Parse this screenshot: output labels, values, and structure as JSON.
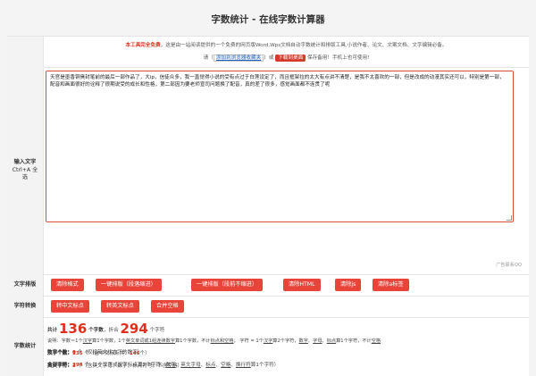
{
  "title": "字数统计 - 在线字数计算器",
  "notice": {
    "highlight": "本工具完全免费",
    "line1_rest": "，这是由一站阅读提供的一个免费的网页版Word,Wps文档自动字数统计和排版工具,小说作者、论文、文案文档、文字编辑必备。",
    "line2_prefix": "请（",
    "favorite_link": "添加到浏览器收藏夹",
    "line2_mid": "）或",
    "download_button": "下载到桌面",
    "line2_suffix": "保存备用！手机上也可使用!"
  },
  "input": {
    "label_line1": "输入文字",
    "label_line2": "Ctrl+A 全",
    "label_line3": "选",
    "text": "天官是墨香铜臭封笔前的最后一部作品了，大ip，信徒众多，我一直觉得小说的受有点过于白莲设定了，而且框架拉的太大有点讲不清楚，是我不太喜欢的一部，但是改成的动漫其实还可以，特别是第一部，配音和画面很好的诠释了很期说受的成长和性格，第二部因为要老师宣司问题换了配音，真的差了很多，感觉画面都不连贯了呢",
    "ad_note": "广告联系QQ"
  },
  "format": {
    "label": "文字排版",
    "buttons": [
      "清除格式",
      "一键排版（段落缩进）",
      "一键排版（段前不缩进）",
      "清除HTML",
      "清除js",
      "清除a标签"
    ]
  },
  "convert": {
    "label": "字符转换",
    "buttons": [
      "转中文标点",
      "转英文标点",
      "合并空格"
    ]
  },
  "stats": {
    "label": "字数统计",
    "total_prefix": "共计",
    "total_count": "136",
    "total_unit": "个字数",
    "total_mid": "，折合",
    "char_count": "294",
    "char_unit": "个字符",
    "explain_prefix": "说明：",
    "explain_a": "字数＝1个",
    "explain_b": "汉字",
    "explain_c": "算1个字数，1个",
    "explain_d": "英文单词或1组连续数字",
    "explain_e": "算1个字数，不计",
    "explain_f": "标点和空格",
    "explain_g": "；  字符 = 1个",
    "explain_h": "汉字",
    "explain_i": "算2个字符，",
    "explain_j": "数字",
    "explain_k": "、",
    "explain_l": "字母",
    "explain_m": "、",
    "explain_n": "标点",
    "explain_o": "算1个字符，不计",
    "explain_p": "空格",
    "hanzi_label": "汉字个数：",
    "hanzi_count": "135",
    "hanzi_mid": "个（含中文标点共：",
    "hanzi_with_punct": "146",
    "hanzi_end": "个）",
    "english_label": "英文字符：",
    "english_count": "2",
    "english_desc": "个（含英文字母、数字、标点符号，不含空格）",
    "digit_label": "数字个数：",
    "digit_count": "0",
    "digit_desc": "个（仅指英文状态下的数字）",
    "all_label": "全部字符：",
    "all_count": "294",
    "all_desc_a": "个（1个汉字或汉字标点算2个字符，",
    "all_desc_b": "数字",
    "all_desc_c": "、",
    "all_desc_d": "英文字母",
    "all_desc_e": "、",
    "all_desc_f": "标点",
    "all_desc_g": "、",
    "all_desc_h": "空格",
    "all_desc_i": "、",
    "all_desc_j": "换行符",
    "all_desc_k": "算1个字符）"
  },
  "colors": {
    "accent": "#e9443a",
    "link": "#1a5fbf"
  }
}
